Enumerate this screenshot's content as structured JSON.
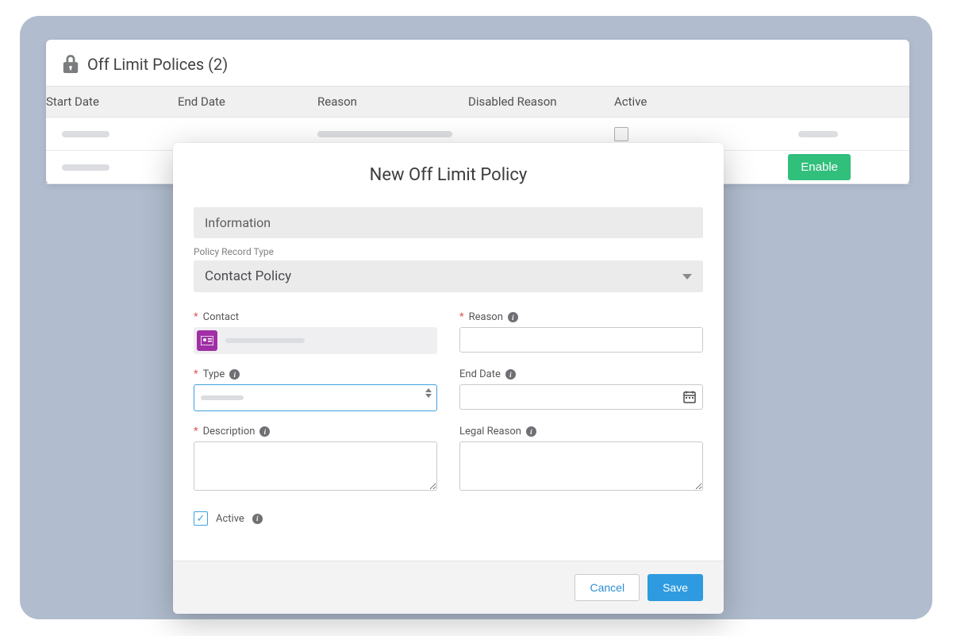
{
  "card": {
    "title": "Off Limit Polices (2)",
    "columns": {
      "start": "Start Date",
      "end": "End Date",
      "reason": "Reason",
      "disabled": "Disabled Reason",
      "active": "Active"
    },
    "enable_label": "Enable"
  },
  "modal": {
    "title": "New Off Limit Policy",
    "section": "Information",
    "record_type_label": "Policy Record Type",
    "record_type_value": "Contact Policy",
    "fields": {
      "contact": "Contact",
      "type": "Type",
      "description": "Description",
      "reason": "Reason",
      "end_date": "End Date",
      "legal_reason": "Legal Reason",
      "active": "Active"
    },
    "active_checked": true,
    "buttons": {
      "cancel": "Cancel",
      "save": "Save"
    }
  }
}
